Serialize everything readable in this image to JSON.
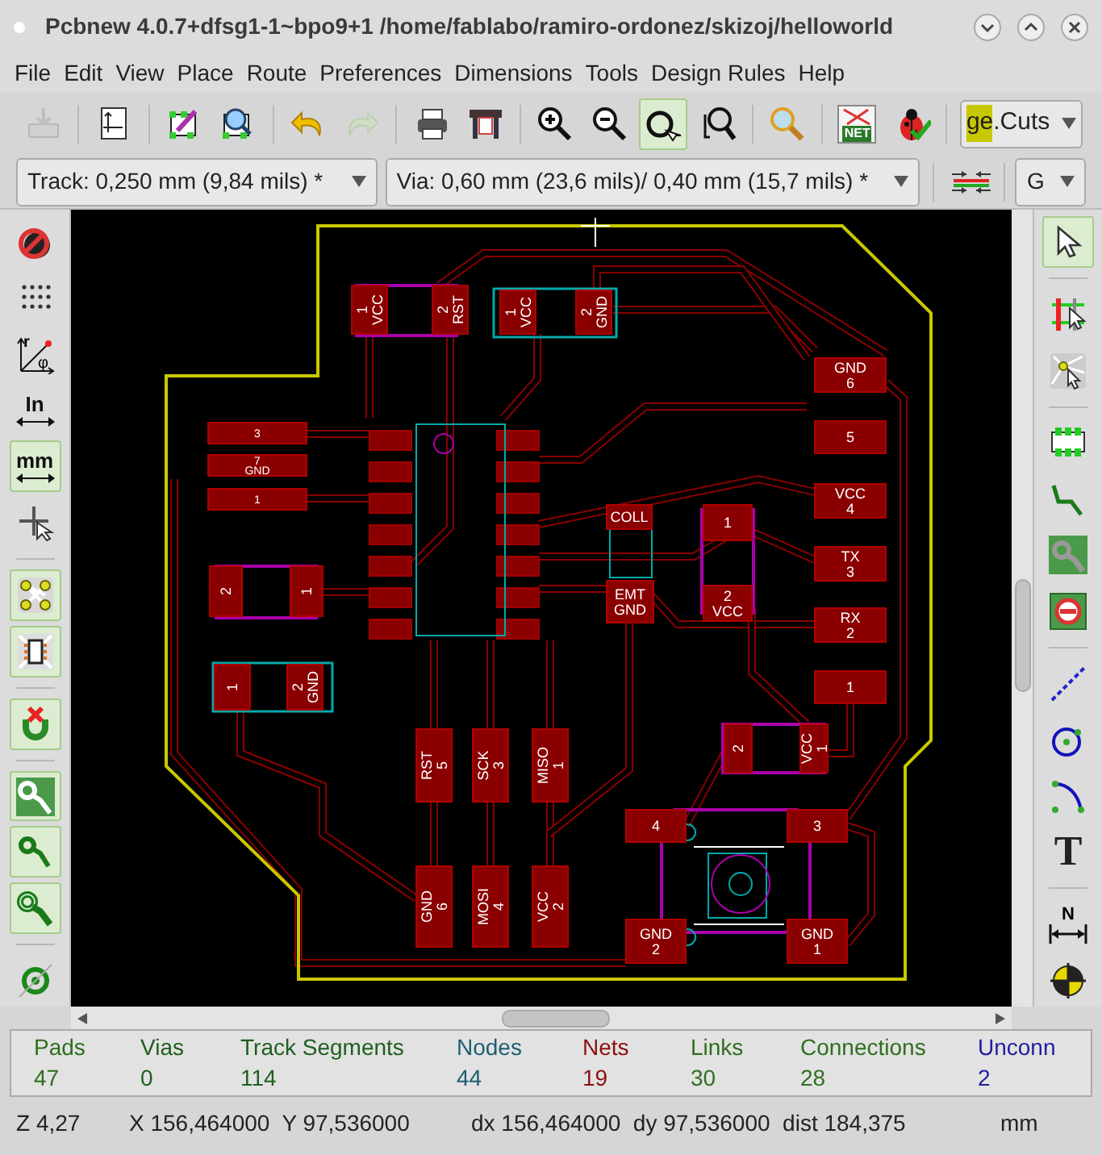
{
  "window": {
    "title": "Pcbnew 4.0.7+dfsg1-1~bpo9+1 /home/fablabo/ramiro-ordonez/skizoj/helloworld"
  },
  "menu": [
    "File",
    "Edit",
    "View",
    "Place",
    "Route",
    "Preferences",
    "Dimensions",
    "Tools",
    "Design Rules",
    "Help"
  ],
  "top_toolbar": [
    {
      "disabled": true,
      "selected": false
    },
    {
      "disabled": false,
      "selected": false
    },
    {
      "disabled": false,
      "selected": false
    },
    {
      "disabled": false,
      "selected": false
    },
    {
      "disabled": false,
      "selected": false
    },
    {
      "disabled": true,
      "selected": false
    },
    {
      "disabled": false,
      "selected": false
    },
    {
      "disabled": false,
      "selected": false
    },
    {
      "disabled": false,
      "selected": false
    },
    {
      "disabled": false,
      "selected": false
    },
    {
      "disabled": false,
      "selected": true
    },
    {
      "disabled": false,
      "selected": false
    },
    {
      "disabled": false,
      "selected": false
    },
    {
      "disabled": false,
      "selected": false,
      "text": "NET"
    },
    {
      "disabled": false,
      "selected": false
    }
  ],
  "layer_select": {
    "value": "ge.Cuts",
    "color": "#c8c800"
  },
  "track_select": {
    "value": "Track: 0,250 mm (9,84 mils) *"
  },
  "via_select": {
    "value": "Via: 0,60 mm (23,6 mils)/ 0,40 mm (15,7 mils) *"
  },
  "grid_select": {
    "value": "G"
  },
  "left_toolbar": [
    {
      "selected": false
    },
    {
      "selected": false
    },
    {
      "selected": false,
      "texts": [
        "r",
        "φ"
      ]
    },
    {
      "selected": false,
      "texts": [
        "In"
      ]
    },
    {
      "selected": true,
      "texts": [
        "mm"
      ]
    },
    {
      "selected": false
    },
    {
      "selected": true
    },
    {
      "selected": true
    },
    {
      "selected": true
    },
    {
      "selected": true
    },
    {
      "selected": true
    },
    {
      "selected": true
    },
    {
      "selected": false
    }
  ],
  "right_toolbar": [
    {
      "selected": true
    },
    {
      "selected": false
    },
    {
      "selected": false
    },
    {
      "selected": false
    },
    {
      "selected": false
    },
    {
      "selected": false
    },
    {
      "selected": false
    },
    {
      "selected": false
    },
    {
      "selected": false
    },
    {
      "selected": false
    },
    {
      "selected": false,
      "texts": [
        "T"
      ]
    },
    {
      "selected": false,
      "texts": [
        "N"
      ]
    },
    {
      "selected": false
    }
  ],
  "board": {
    "pads": [
      {
        "lines": [
          "1",
          "VCC"
        ]
      },
      {
        "lines": [
          "2",
          "RST"
        ]
      },
      {
        "lines": [
          "1",
          "VCC"
        ]
      },
      {
        "lines": [
          "2",
          "GND"
        ]
      },
      {
        "lines": [
          "GND",
          "6"
        ]
      },
      {
        "lines": [
          "3"
        ]
      },
      {
        "lines": [
          "5"
        ]
      },
      {
        "lines": [
          "7",
          "GND"
        ]
      },
      {
        "lines": [
          "1"
        ]
      },
      {
        "lines": [
          "VCC",
          "4"
        ]
      },
      {
        "lines": [
          "COLL"
        ]
      },
      {
        "lines": [
          "1"
        ]
      },
      {
        "lines": [
          "TX",
          "3"
        ]
      },
      {
        "lines": [
          "2"
        ]
      },
      {
        "lines": [
          "1"
        ]
      },
      {
        "lines": [
          "EMT",
          "GND"
        ]
      },
      {
        "lines": [
          "2",
          "VCC"
        ]
      },
      {
        "lines": [
          "RX",
          "2"
        ]
      },
      {
        "lines": [
          "1"
        ]
      },
      {
        "lines": [
          "2",
          "GND"
        ]
      },
      {
        "lines": [
          "1"
        ]
      },
      {
        "lines": [
          "2"
        ]
      },
      {
        "lines": [
          "VCC",
          "1"
        ]
      },
      {
        "lines": [
          "RST",
          "5"
        ]
      },
      {
        "lines": [
          "SCK",
          "3"
        ]
      },
      {
        "lines": [
          "MISO",
          "1"
        ]
      },
      {
        "lines": [
          "4"
        ]
      },
      {
        "lines": [
          "3"
        ]
      },
      {
        "lines": [
          "GND",
          "6"
        ]
      },
      {
        "lines": [
          "MOSI",
          "4"
        ]
      },
      {
        "lines": [
          "VCC",
          "2"
        ]
      },
      {
        "lines": [
          "GND",
          "2"
        ]
      },
      {
        "lines": [
          "GND",
          "1"
        ]
      }
    ]
  },
  "stats": [
    {
      "label": "Pads",
      "value": "47",
      "color": "#2f6f1f"
    },
    {
      "label": "Vias",
      "value": "0",
      "color": "#1f5f1f"
    },
    {
      "label": "Track Segments",
      "value": "114",
      "color": "#1f5f1f"
    },
    {
      "label": "Nodes",
      "value": "44",
      "color": "#1f5f70"
    },
    {
      "label": "Nets",
      "value": "19",
      "color": "#8b1010"
    },
    {
      "label": "Links",
      "value": "30",
      "color": "#2f6f1f"
    },
    {
      "label": "Connections",
      "value": "28",
      "color": "#2f6f1f"
    },
    {
      "label": "Unconn",
      "value": "2",
      "color": "#20209f"
    }
  ],
  "status_bar": {
    "zoom": "Z 4,27",
    "position": "X 156,464000  Y 97,536000",
    "delta": "dx 156,464000  dy 97,536000  dist 184,375",
    "units": "mm"
  }
}
